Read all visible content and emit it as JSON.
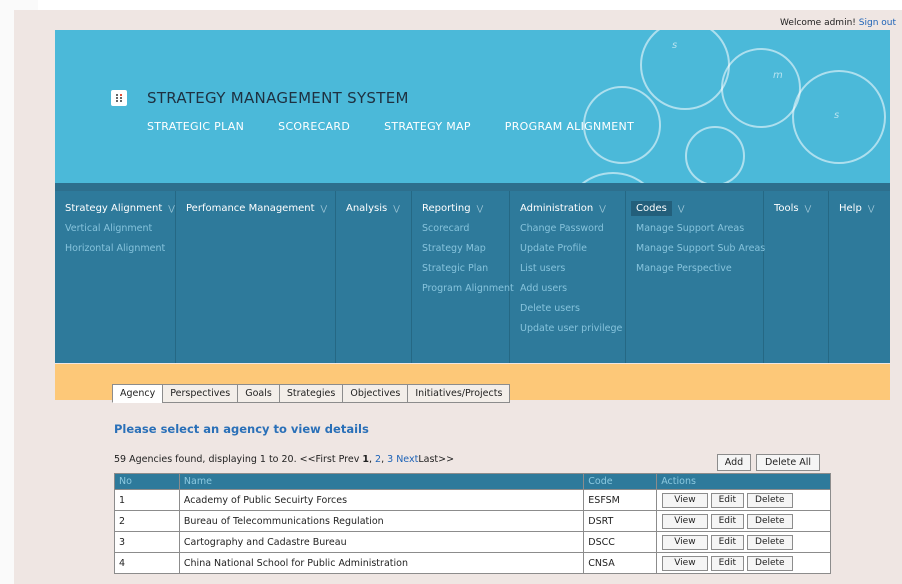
{
  "welcome": {
    "text": "Welcome admin!",
    "signout": "Sign out"
  },
  "side_icon": "C",
  "header": {
    "system_title": "STRATEGY MANAGEMENT SYSTEM",
    "links": [
      "STRATEGIC PLAN",
      "SCORECARD",
      "STRATEGY MAP",
      "PROGRAM ALIGNMENT"
    ],
    "circle_letters": [
      "s",
      "m",
      "s"
    ]
  },
  "menu": [
    {
      "label": "Strategy Alignment",
      "items": [
        "Vertical Alignment",
        "Horizontal Alignment"
      ]
    },
    {
      "label": "Perfomance Management",
      "items": []
    },
    {
      "label": "Analysis",
      "items": []
    },
    {
      "label": "Reporting",
      "items": [
        "Scorecard",
        "Strategy Map",
        "Strategic Plan",
        "Program Alignment"
      ]
    },
    {
      "label": "Administration",
      "items": [
        "Change Password",
        "Update Profile",
        "List users",
        "Add users",
        "Delete users",
        "Update user privilege"
      ]
    },
    {
      "label": "Codes",
      "items": [
        "Manage Support Areas",
        "Manage Support Sub Areas",
        "Manage Perspective"
      ]
    },
    {
      "label": "Tools",
      "items": []
    },
    {
      "label": "Help",
      "items": []
    }
  ],
  "tabs": [
    "Agency",
    "Perspectives",
    "Goals",
    "Strategies",
    "Objectives",
    "Initiatives/Projects"
  ],
  "content": {
    "title": "Please select an agency to view details",
    "found_prefix": "59 Agencies found, displaying 1 to 20. ",
    "pager_first": "<<First",
    "pager_prev": "Prev",
    "pager_current": "1",
    "pager_p2": "2",
    "pager_p3": "3",
    "pager_next": "Next",
    "pager_last": "Last>>",
    "add_label": "Add",
    "delete_all_label": "Delete All"
  },
  "table": {
    "headers": [
      "No",
      "Name",
      "Code",
      "Actions"
    ],
    "rows": [
      {
        "no": "1",
        "name": "Academy of Public Secuirty Forces",
        "code": "ESFSM"
      },
      {
        "no": "2",
        "name": "Bureau of Telecommunications Regulation",
        "code": "DSRT"
      },
      {
        "no": "3",
        "name": "Cartography and Cadastre Bureau",
        "code": "DSCC"
      },
      {
        "no": "4",
        "name": "China National School for Public Administration",
        "code": "CNSA"
      }
    ],
    "action_labels": {
      "view": "View",
      "edit": "Edit",
      "delete": "Delete"
    }
  }
}
